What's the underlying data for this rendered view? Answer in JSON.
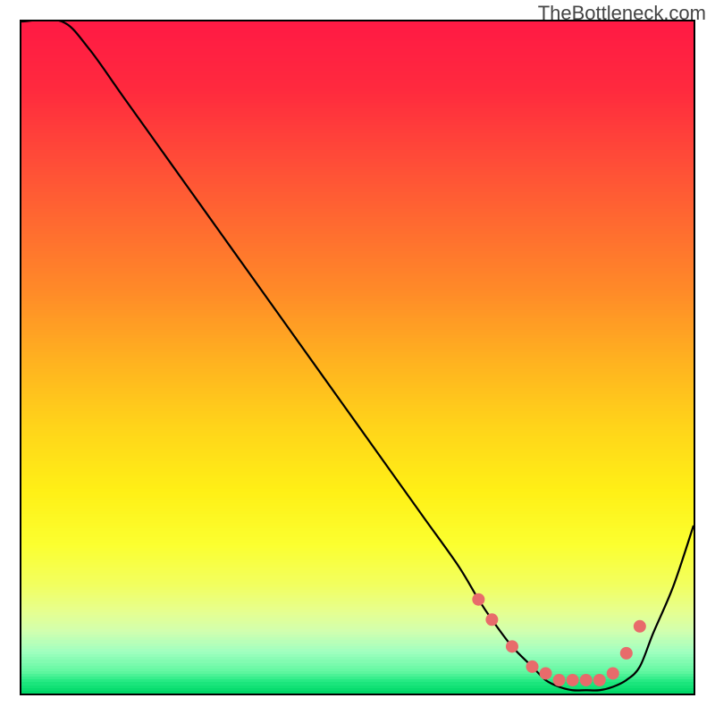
{
  "watermark": "TheBottleneck.com",
  "chart_data": {
    "type": "line",
    "title": "",
    "xlabel": "",
    "ylabel": "",
    "xlim": [
      0,
      100
    ],
    "ylim": [
      0,
      100
    ],
    "x": [
      0,
      6,
      10,
      15,
      20,
      25,
      30,
      35,
      40,
      45,
      50,
      55,
      60,
      65,
      68,
      70,
      73,
      76,
      78,
      80,
      82,
      84,
      86,
      88,
      90,
      92,
      94,
      97,
      100
    ],
    "y": [
      100,
      100,
      96,
      89,
      82,
      75,
      68,
      61,
      54,
      47,
      40,
      33,
      26,
      19,
      14,
      11,
      7,
      4,
      2,
      1,
      0.5,
      0.5,
      0.5,
      1,
      2,
      4,
      9,
      16,
      25
    ],
    "markers_x": [
      68,
      70,
      73,
      76,
      78,
      80,
      82,
      84,
      86,
      88,
      90,
      92
    ],
    "markers_y": [
      14,
      11,
      7,
      4,
      3,
      2,
      2,
      2,
      2,
      3,
      6,
      10
    ],
    "marker_color": "#e86b6b",
    "curve_color": "#000000",
    "gradient_stops": [
      {
        "pos": 0.0,
        "color": "#ff1a44"
      },
      {
        "pos": 0.1,
        "color": "#ff2a3e"
      },
      {
        "pos": 0.2,
        "color": "#ff4a38"
      },
      {
        "pos": 0.3,
        "color": "#ff6a30"
      },
      {
        "pos": 0.4,
        "color": "#ff8a28"
      },
      {
        "pos": 0.5,
        "color": "#ffb020"
      },
      {
        "pos": 0.6,
        "color": "#ffd31a"
      },
      {
        "pos": 0.7,
        "color": "#fff016"
      },
      {
        "pos": 0.78,
        "color": "#fbff30"
      },
      {
        "pos": 0.84,
        "color": "#f2ff60"
      },
      {
        "pos": 0.88,
        "color": "#e6ff90"
      },
      {
        "pos": 0.91,
        "color": "#d0ffb0"
      },
      {
        "pos": 0.94,
        "color": "#a0ffc0"
      },
      {
        "pos": 0.97,
        "color": "#60f7a0"
      },
      {
        "pos": 0.985,
        "color": "#20e880"
      },
      {
        "pos": 1.0,
        "color": "#00d868"
      }
    ]
  }
}
